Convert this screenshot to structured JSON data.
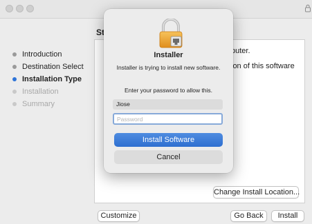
{
  "window": {
    "heading_peek": "St"
  },
  "sidebar": {
    "items": [
      {
        "label": "Introduction"
      },
      {
        "label": "Destination Select"
      },
      {
        "label": "Installation Type"
      },
      {
        "label": "Installation"
      },
      {
        "label": "Summary"
      }
    ]
  },
  "content": {
    "line1": "puter.",
    "line2": "ion of this software"
  },
  "buttons": {
    "change_location": "Change Install Location...",
    "customize": "Customize",
    "go_back": "Go Back",
    "install": "Install"
  },
  "dialog": {
    "icon": "lock-icon",
    "title": "Installer",
    "message": "Installer is trying to install new software.",
    "prompt": "Enter your password to allow this.",
    "username_value": "Jiose",
    "password_placeholder": "Password",
    "install_label": "Install Software",
    "cancel_label": "Cancel"
  },
  "colors": {
    "accent": "#2e74d8",
    "primary_button": "#2e6fd0"
  }
}
